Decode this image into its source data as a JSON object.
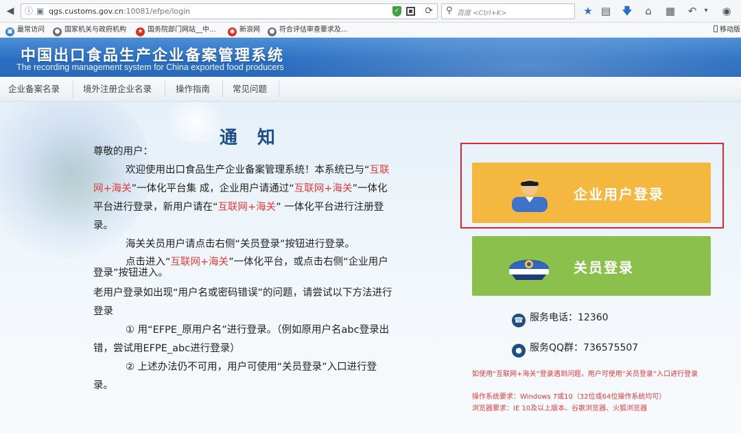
{
  "browser": {
    "url_host": "qgs.customs.gov.cn",
    "url_path": ":10081/efpe/login",
    "search_placeholder": "百度 <Ctrl+K>",
    "bookmarks": [
      {
        "label": "最常访问",
        "icon_color": "#3b7cc9"
      },
      {
        "label": "国家机关与政府机构",
        "icon_color": "#6b6f75"
      },
      {
        "label": "国务院部门网站__中...",
        "icon_color": "#d8301e"
      },
      {
        "label": "新浪网",
        "icon_color": "#d8301e"
      },
      {
        "label": "符合评估审查要求及...",
        "icon_color": "#6b6f75"
      }
    ],
    "mobile_bookmark": "移动版"
  },
  "header": {
    "title": "中国出口食品生产企业备案管理系统",
    "subtitle": "The recording management system for China exported food producers"
  },
  "nav": {
    "items": [
      {
        "label": "企业备案名录"
      },
      {
        "label": "境外注册企业名录"
      },
      {
        "label": "操作指南"
      },
      {
        "label": "常见问题"
      }
    ]
  },
  "notice": {
    "title": "通 知",
    "greeting": "尊敬的用户：",
    "p1_a": "欢迎使用出口食品生产企业备案管理系统！本系统已与“",
    "p1_hl1": "互联网+海关",
    "p1_b": "”一体化平台集 成，企业用户请通过“",
    "p1_hl2": "互联网+海关",
    "p1_c": "”一体化平台进行登录，新用户请在“",
    "p1_hl3": "互联网+海关",
    "p1_d": "” 一体化平台进行注册登录。",
    "p2": "海关关员用户请点击右侧“关员登录”按钮进行登录。",
    "p3_a": "点击进入“",
    "p3_hl": "互联网+海关",
    "p3_b": "”一体化平台，或点击右侧“企业用户登录”按钮进入。",
    "p4": "老用户登录如出现“用户名或密码错误”的问题，请尝试以下方法进行登录",
    "p5": "① 用“EFPE_原用户名”进行登录。（例如原用户名abc登录出错，尝试用EFPE_abc进行登录）",
    "p6": "② 上述办法仍不可用，用户可使用“关员登录”入口进行登录。"
  },
  "login": {
    "enterprise_label": "企业用户登录",
    "customs_label": "关员登录",
    "enterprise_color": "#f4b840",
    "customs_color": "#8cc04c",
    "frame_color": "#e3262d"
  },
  "service": {
    "phone": "服务电话：12360",
    "qq": "服务QQ群：736575507",
    "tip": "如使用“互联网+海关”登录遇到问题，用户可使用“关员登录”入口进行登录",
    "os_req": "操作系统要求：Windows 7或10（32位或64位操作系统均可）",
    "browser_req": "浏览器要求：IE 10及以上版本、谷歌浏览器、火狐浏览器"
  }
}
